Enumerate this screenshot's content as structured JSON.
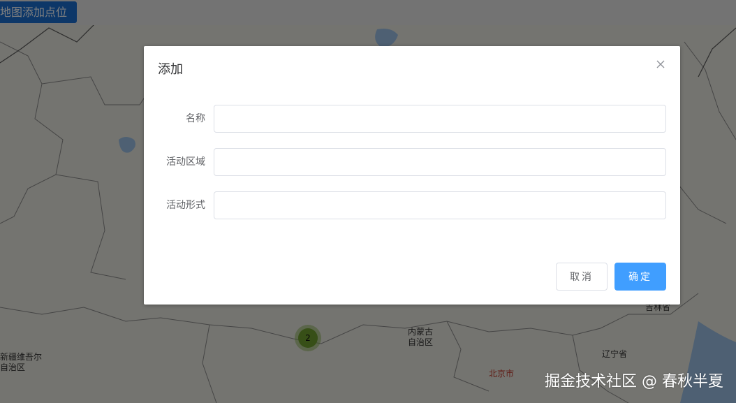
{
  "page": {
    "add_point_button": "地图添加点位"
  },
  "map": {
    "labels": [
      {
        "id": "xinjiang",
        "text": "新疆维吾尔\n自治区"
      },
      {
        "id": "neimenggu",
        "text": "内蒙古\n自治区"
      },
      {
        "id": "jilin",
        "text": "吉林省"
      },
      {
        "id": "liaoning",
        "text": "辽宁省"
      },
      {
        "id": "beijing",
        "text": "北京市"
      }
    ],
    "cluster_count": "2"
  },
  "dialog": {
    "title": "添加",
    "fields": [
      {
        "label": "名称",
        "value": "",
        "placeholder": ""
      },
      {
        "label": "活动区域",
        "value": "",
        "placeholder": ""
      },
      {
        "label": "活动形式",
        "value": "",
        "placeholder": ""
      }
    ],
    "cancel_label": "取消",
    "confirm_label": "确定"
  },
  "watermark": "掘金技术社区 @ 春秋半夏",
  "colors": {
    "primary": "#409eff",
    "map_button": "#1b6fd1",
    "cluster": "#6e9f2e"
  }
}
